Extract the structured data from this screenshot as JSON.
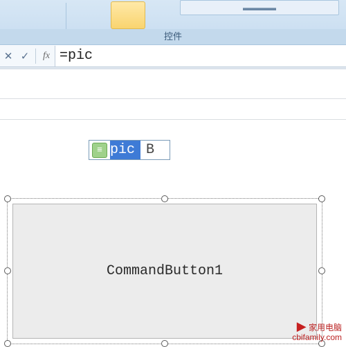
{
  "ribbon": {
    "group_label": "控件",
    "btn_truncated": "▬▬▬▬"
  },
  "formula_bar": {
    "cancel_glyph": "✕",
    "accept_glyph": "✓",
    "fx_label": "fx",
    "value": "=pic"
  },
  "autocomplete": {
    "selected": "pic",
    "rest": "B"
  },
  "command_button": {
    "caption": "CommandButton1"
  },
  "watermark": {
    "line1": "家用电脑",
    "line2": "cbifamily.com"
  }
}
